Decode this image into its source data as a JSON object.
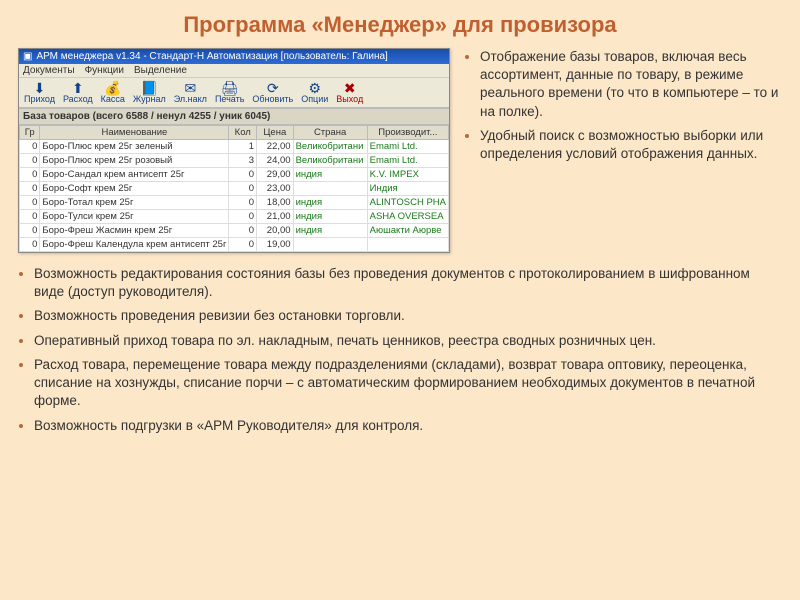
{
  "title": "Программа «Менеджер» для провизора",
  "app": {
    "titlebar": "АРМ менеджера v1.34 - Стандарт-Н Автоматизация [пользователь: Галина]",
    "menu": {
      "m1": "Документы",
      "m2": "Функции",
      "m3": "Выделение"
    },
    "toolbar": {
      "prihod": "Приход",
      "rashod": "Расход",
      "kassa": "Касса",
      "jurnal": "Журнал",
      "elnakl": "Эл.накл",
      "print": "Печать",
      "refresh": "Обновить",
      "options": "Опции",
      "exit": "Выход"
    },
    "base_header": "База товаров (всего 6588 / ненул 4255 / уник 6045)",
    "cols": {
      "gr": "Гр",
      "name": "Наименование",
      "kol": "Кол",
      "price": "Цена",
      "country": "Страна",
      "maker": "Производит..."
    },
    "rows": [
      {
        "gr": "0",
        "name": "Боро-Плюс крем 25г зеленый",
        "kol": "1",
        "price": "22,00",
        "country": "Великобритани",
        "maker": "Emami Ltd."
      },
      {
        "gr": "0",
        "name": "Боро-Плюс крем 25г розовый",
        "kol": "3",
        "price": "24,00",
        "country": "Великобритани",
        "maker": "Emami Ltd."
      },
      {
        "gr": "0",
        "name": "Боро-Сандал крем антисепт 25г",
        "kol": "0",
        "price": "29,00",
        "country": "индия",
        "maker": "K.V. IMPEX"
      },
      {
        "gr": "0",
        "name": "Боро-Софт крем 25г",
        "kol": "0",
        "price": "23,00",
        "country": "",
        "maker": "Индия"
      },
      {
        "gr": "0",
        "name": "Боро-Тотал крем 25г",
        "kol": "0",
        "price": "18,00",
        "country": "индия",
        "maker": "ALINTOSCH PHA"
      },
      {
        "gr": "0",
        "name": "Боро-Тулси крем 25г",
        "kol": "0",
        "price": "21,00",
        "country": "индия",
        "maker": "ASHA OVERSEA"
      },
      {
        "gr": "0",
        "name": "Боро-Фреш Жасмин крем 25г",
        "kol": "0",
        "price": "20,00",
        "country": "индия",
        "maker": "Аюшакти Аюрве"
      },
      {
        "gr": "0",
        "name": "Боро-Фреш Календула крем антисепт 25г",
        "kol": "0",
        "price": "19,00",
        "country": "",
        "maker": ""
      }
    ]
  },
  "right_bullets": [
    "Отображение базы товаров, включая весь ассортимент, данные по товару, в режиме реального времени (то что в компьютере – то и на полке).",
    "Удобный поиск с возможностью выборки или определения условий отображения данных."
  ],
  "bottom_bullets": [
    "Возможность редактирования состояния базы без проведения документов с протоколированием в шифрованном виде (доступ руководителя).",
    "Возможность проведения ревизии без остановки торговли.",
    "Оперативный приход товара по эл. накладным, печать ценников, реестра сводных розничных цен.",
    "Расход товара, перемещение товара между подразделениями (складами), возврат товара оптовику, переоценка, списание на хознужды, списание порчи – с автоматическим формированием необходимых документов в печатной форме.",
    "Возможность подгрузки в «АРМ Руководителя» для контроля."
  ]
}
